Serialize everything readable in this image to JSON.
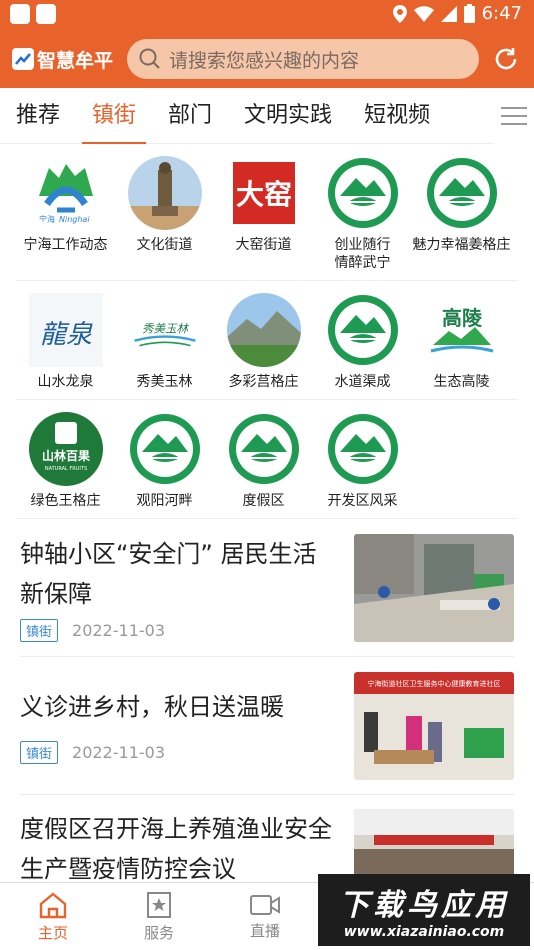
{
  "status_bar": {
    "time": "6:47"
  },
  "app": {
    "name": "智慧牟平",
    "search_placeholder": "请搜索您感兴趣的内容"
  },
  "tabs": [
    {
      "label": "推荐",
      "active": false
    },
    {
      "label": "镇街",
      "active": true
    },
    {
      "label": "部门",
      "active": false
    },
    {
      "label": "文明实践",
      "active": false
    },
    {
      "label": "短视频",
      "active": false
    }
  ],
  "grid": {
    "rows": [
      [
        {
          "label": "宁海工作动态",
          "icon": "ninghai-logo-icon",
          "logo_text": "Ninghai",
          "logo_sub": "宁海"
        },
        {
          "label": "文化街道",
          "icon": "statue-photo-icon"
        },
        {
          "label": "大窑街道",
          "icon": "dayao-logo-icon",
          "logo_text": "大窑"
        },
        {
          "label": "创业随行\n情醉武宁",
          "icon": "green-mountain-logo-icon"
        },
        {
          "label": "魅力幸福姜格庄",
          "icon": "green-mountain-logo-icon"
        }
      ],
      [
        {
          "label": "山水龙泉",
          "icon": "longquan-calligraphy-icon",
          "logo_text": "龍泉"
        },
        {
          "label": "秀美玉林",
          "icon": "yulin-calligraphy-icon",
          "logo_text": "秀美玉林"
        },
        {
          "label": "多彩莒格庄",
          "icon": "mountain-photo-icon"
        },
        {
          "label": "水道渠成",
          "icon": "green-mountain-logo-icon"
        },
        {
          "label": "生态高陵",
          "icon": "gaoling-logo-icon",
          "logo_text": "高陵"
        }
      ],
      [
        {
          "label": "绿色王格庄",
          "icon": "shanlin-baiguo-logo-icon",
          "logo_text": "山林百果",
          "logo_sub": "NATURAL FRUITS"
        },
        {
          "label": "观阳河畔",
          "icon": "green-mountain-logo-icon"
        },
        {
          "label": "度假区",
          "icon": "green-mountain-logo-icon"
        },
        {
          "label": "开发区风采",
          "icon": "green-mountain-logo-icon"
        }
      ]
    ]
  },
  "news": [
    {
      "title": "钟轴小区“安全门” 居民生活新保障",
      "tag": "镇街",
      "date": "2022-11-03",
      "thumb": "workers-photo"
    },
    {
      "title": "义诊进乡村，秋日送温暖",
      "tag": "镇街",
      "date": "2022-11-03",
      "thumb": "clinic-photo",
      "banner_text": "宁海街道社区卫生服务中心健康教育进社区"
    },
    {
      "title": "度假区召开海上养殖渔业安全生产暨疫情防控会议",
      "tag": "",
      "date": "",
      "thumb": "meeting-photo"
    }
  ],
  "bottom_nav": [
    {
      "label": "主页",
      "icon": "home-icon",
      "active": true
    },
    {
      "label": "服务",
      "icon": "star-bookmark-icon",
      "active": false
    },
    {
      "label": "直播",
      "icon": "video-camera-icon",
      "active": false
    }
  ],
  "watermark": {
    "big": "下载鸟应用",
    "small": "www.xiazainiao.com"
  },
  "colors": {
    "brand": "#e8632c",
    "tag": "#3a8ad3",
    "logo_green": "#1e9a52"
  }
}
